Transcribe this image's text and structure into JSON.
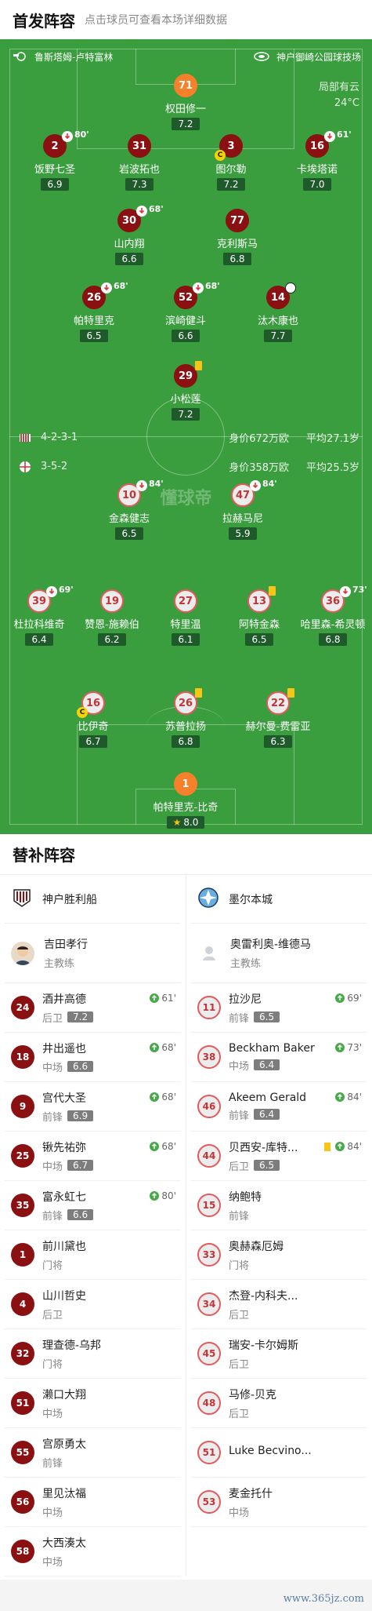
{
  "header": {
    "title": "首发阵容",
    "subtitle": "点击球员可查看本场详细数据"
  },
  "venue": {
    "home_team": "鲁斯塔姆-卢特富林",
    "stadium": "神户御崎公园球技场"
  },
  "weather": {
    "condition": "局部有云",
    "temp": "24°C"
  },
  "watermark": "懂球帝",
  "home": {
    "formation": "4-2-3-1",
    "value": "身价672万欧",
    "avg_age": "平均27.1岁",
    "players": [
      {
        "num": "71",
        "name": "权田修一",
        "rating": "7.2",
        "gk": true
      },
      {
        "num": "2",
        "name": "饭野七圣",
        "rating": "6.9",
        "sub": "80'"
      },
      {
        "num": "31",
        "name": "岩波拓也",
        "rating": "7.3"
      },
      {
        "num": "3",
        "name": "图尔勒",
        "rating": "7.2",
        "captain": "C"
      },
      {
        "num": "16",
        "name": "卡埃塔诺",
        "rating": "7.0",
        "sub": "61'"
      },
      {
        "num": "30",
        "name": "山内翔",
        "rating": "6.6",
        "sub": "68'"
      },
      {
        "num": "77",
        "name": "克利斯马",
        "rating": "6.8"
      },
      {
        "num": "26",
        "name": "帕特里克",
        "rating": "6.5",
        "sub": "68'"
      },
      {
        "num": "52",
        "name": "滨崎健斗",
        "rating": "6.6",
        "sub": "68'"
      },
      {
        "num": "14",
        "name": "汰木康也",
        "rating": "7.7",
        "goal": true
      },
      {
        "num": "29",
        "name": "小松莲",
        "rating": "7.2",
        "yellow": true
      }
    ]
  },
  "away": {
    "formation": "3-5-2",
    "value": "身价358万欧",
    "avg_age": "平均25.5岁",
    "players": [
      {
        "num": "10",
        "name": "金森健志",
        "rating": "6.5",
        "sub": "84'"
      },
      {
        "num": "47",
        "name": "拉赫马尼",
        "rating": "5.9",
        "sub": "84'"
      },
      {
        "num": "39",
        "name": "杜拉科维奇",
        "rating": "6.4",
        "sub": "69'"
      },
      {
        "num": "19",
        "name": "赞恩-施赖伯",
        "rating": "6.2"
      },
      {
        "num": "27",
        "name": "特里温",
        "rating": "6.1"
      },
      {
        "num": "13",
        "name": "阿特金森",
        "rating": "6.5",
        "yellow": true
      },
      {
        "num": "36",
        "name": "哈里森-希灵顿",
        "rating": "6.8",
        "sub": "73'"
      },
      {
        "num": "16",
        "name": "比伊奇",
        "rating": "6.7",
        "captain": "C"
      },
      {
        "num": "26",
        "name": "苏普拉扬",
        "rating": "6.8",
        "yellow": true
      },
      {
        "num": "22",
        "name": "赫尔曼-费雷亚",
        "rating": "6.3",
        "yellow": true
      },
      {
        "num": "1",
        "name": "帕特里克-比奇",
        "rating": "8.0",
        "gk": true,
        "star": true
      }
    ]
  },
  "subs": {
    "title": "替补阵容",
    "home": {
      "team_name": "神户胜利船",
      "coach": {
        "name": "吉田孝行",
        "role": "主教练"
      },
      "players": [
        {
          "num": "24",
          "name": "酒井高德",
          "pos": "后卫",
          "rating": "7.2",
          "in": "61'"
        },
        {
          "num": "18",
          "name": "井出遥也",
          "pos": "中场",
          "rating": "6.6",
          "in": "68'"
        },
        {
          "num": "9",
          "name": "宫代大圣",
          "pos": "前锋",
          "rating": "6.9",
          "in": "68'"
        },
        {
          "num": "25",
          "name": "锹先祐弥",
          "pos": "中场",
          "rating": "6.7",
          "in": "68'"
        },
        {
          "num": "35",
          "name": "富永虹七",
          "pos": "前锋",
          "rating": "6.6",
          "in": "80'"
        },
        {
          "num": "1",
          "name": "前川黛也",
          "pos": "门将"
        },
        {
          "num": "4",
          "name": "山川哲史",
          "pos": "后卫"
        },
        {
          "num": "32",
          "name": "理查德-乌邦",
          "pos": "门将"
        },
        {
          "num": "51",
          "name": "濑口大翔",
          "pos": "中场"
        },
        {
          "num": "55",
          "name": "宫原勇太",
          "pos": "前锋"
        },
        {
          "num": "56",
          "name": "里见汰福",
          "pos": "中场"
        },
        {
          "num": "58",
          "name": "大西湊太",
          "pos": "中场"
        }
      ]
    },
    "away": {
      "team_name": "墨尔本城",
      "coach": {
        "name": "奥雷利奥-维德马",
        "role": "主教练"
      },
      "players": [
        {
          "num": "11",
          "name": "拉沙尼",
          "pos": "前锋",
          "rating": "6.5",
          "in": "69'"
        },
        {
          "num": "38",
          "name": "Beckham Baker",
          "pos": "中场",
          "rating": "6.4",
          "in": "73'"
        },
        {
          "num": "46",
          "name": "Akeem Gerald",
          "pos": "前锋",
          "rating": "6.4",
          "in": "84'"
        },
        {
          "num": "44",
          "name": "贝西安-库特...",
          "pos": "后卫",
          "rating": "6.5",
          "in": "84'",
          "yellow": true
        },
        {
          "num": "15",
          "name": "纳鲍特",
          "pos": "前锋"
        },
        {
          "num": "33",
          "name": "奥赫森厄姆",
          "pos": "门将"
        },
        {
          "num": "34",
          "name": "杰登-内科夫...",
          "pos": "后卫"
        },
        {
          "num": "45",
          "name": "瑞安-卡尔姆斯",
          "pos": "后卫"
        },
        {
          "num": "48",
          "name": "马修-贝克",
          "pos": "后卫"
        },
        {
          "num": "51",
          "name": "Luke Becvino...",
          "pos": ""
        },
        {
          "num": "53",
          "name": "麦金托什",
          "pos": "中场"
        }
      ]
    }
  },
  "footer": {
    "watermark": "www.365jz.com"
  }
}
